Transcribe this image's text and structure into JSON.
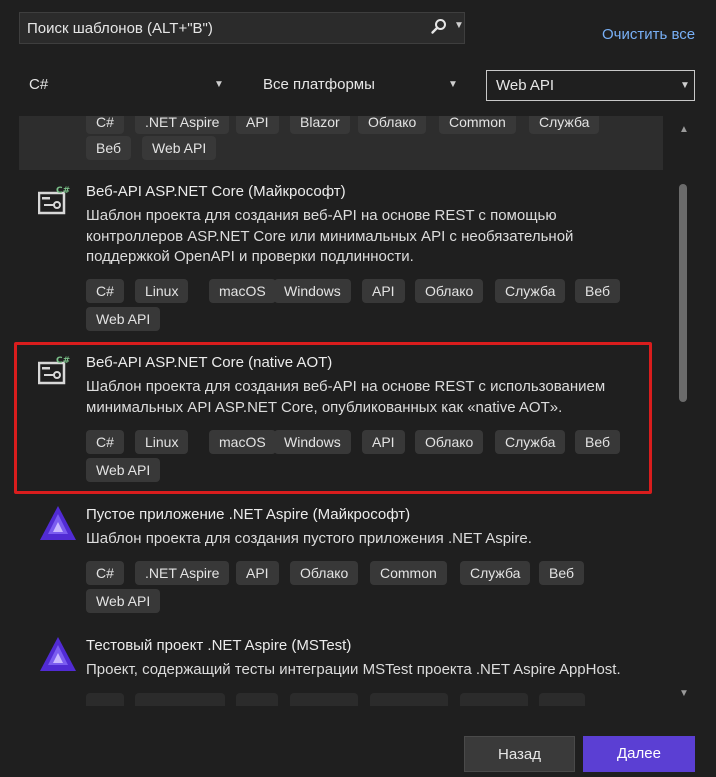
{
  "search": {
    "placeholder": "Поиск шаблонов (ALT+\"В\")",
    "value": ""
  },
  "clear_all": "Очистить все",
  "filters": {
    "language": "C#",
    "platform": "Все платформы",
    "project_type": "Web API"
  },
  "templates": [
    {
      "title": "",
      "description": [],
      "tags": [
        ".NET Aspire",
        "API",
        "Blazor",
        "Облако",
        "Common",
        "Служба",
        "Веб",
        "Web API"
      ]
    },
    {
      "title": "Веб-API ASP.NET Core (Майкрософт)",
      "description": [
        "Шаблон проекта для создания веб-API на основе REST с помощью",
        "контроллеров ASP.NET Core или минимальных API с необязательной",
        "поддержкой OpenAPI и проверки подлинности."
      ],
      "tags": [
        "C#",
        "Linux",
        "macOS",
        "Windows",
        "API",
        "Облако",
        "Служба",
        "Веб",
        "Web API"
      ]
    },
    {
      "title": "Веб-API ASP.NET Core (native AOT)",
      "description": [
        "Шаблон проекта для создания веб-API на основе REST с использованием",
        "минимальных API ASP.NET Core, опубликованных как «native AOT»."
      ],
      "tags": [
        "C#",
        "Linux",
        "macOS",
        "Windows",
        "API",
        "Облако",
        "Служба",
        "Веб",
        "Web API"
      ]
    },
    {
      "title": "Пустое приложение .NET Aspire (Майкрософт)",
      "description": [
        "Шаблон проекта для создания пустого приложения .NET Aspire."
      ],
      "tags": [
        "C#",
        ".NET Aspire",
        "API",
        "Облако",
        "Common",
        "Служба",
        "Веб",
        "Web API"
      ]
    },
    {
      "title": "Тестовый проект .NET Aspire (MSTest)",
      "description": [
        "Проект, содержащий тесты интеграции MSTest проекта .NET Aspire AppHost."
      ],
      "tags": []
    }
  ],
  "buttons": {
    "back": "Назад",
    "next": "Далее"
  },
  "colors": {
    "accent": "#5b3fd3",
    "link": "#78aff5",
    "highlight": "#d91d1d"
  }
}
